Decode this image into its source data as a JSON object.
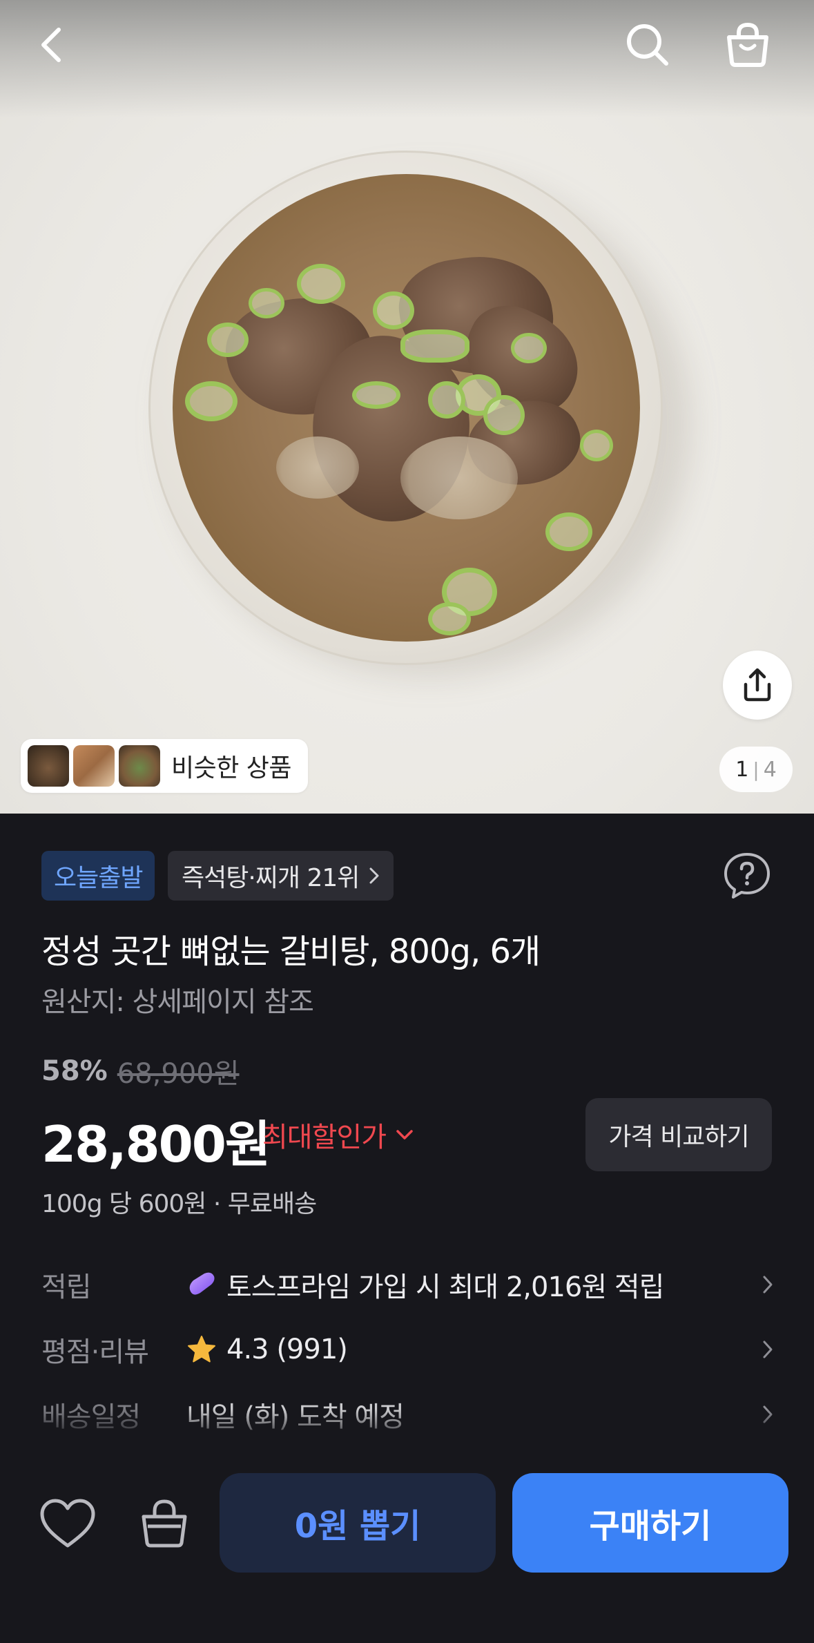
{
  "hero": {
    "page_current": "1",
    "page_separator": "|",
    "page_total": "4",
    "similar_label": "비슷한 상품"
  },
  "badges": {
    "today_ship": "오늘출발",
    "rank": "즉석탕·찌개 21위"
  },
  "product": {
    "title": "정성 곳간 뼈없는 갈비탕, 800g, 6개",
    "origin": "원산지: 상세페이지 참조",
    "discount_rate": "58%",
    "original_price": "68,900원",
    "price": "28,800원",
    "max_discount_label": "최대할인가",
    "compare_label": "가격 비교하기",
    "unit_price": "100g 당 600원 · 무료배송"
  },
  "rows": {
    "points_key": "적립",
    "points_value": "토스프라임 가입 시 최대 2,016원 적립",
    "rating_key": "평점·리뷰",
    "rating_value": "4.3 (991)",
    "ship_key": "배송일정",
    "ship_value": "내일 (화) 도착 예정"
  },
  "actions": {
    "draw_label": "0원 뽑기",
    "buy_label": "구매하기"
  },
  "colors": {
    "accent_blue": "#3b82f6",
    "discount_red": "#f0484f",
    "background": "#17171c",
    "star": "#f5b83d"
  }
}
